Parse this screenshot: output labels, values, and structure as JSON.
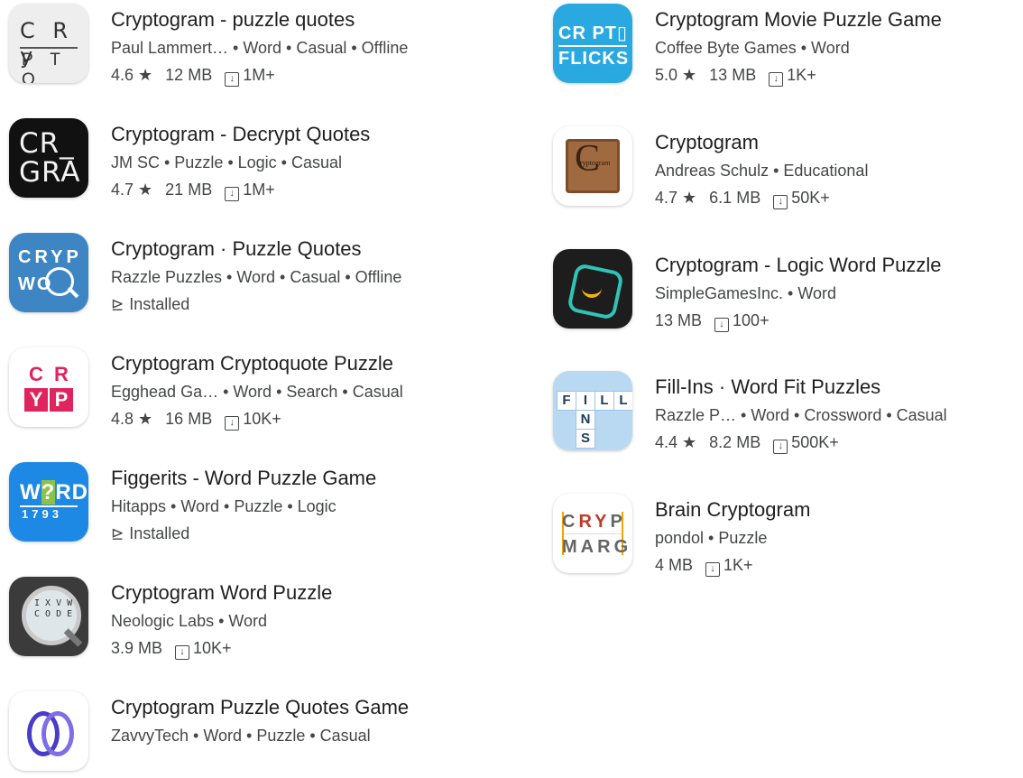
{
  "left_apps": [
    {
      "title": "Cryptogram - puzzle quotes",
      "meta": "Paul Lammert… • Word • Casual • Offline",
      "rating": "4.6 ★",
      "size": "12 MB",
      "downloads": "1M+"
    },
    {
      "title": "Cryptogram - Decrypt Quotes",
      "meta": "JM SC • Puzzle • Logic • Casual",
      "rating": "4.7 ★",
      "size": "21 MB",
      "downloads": "1M+"
    },
    {
      "title": "Cryptogram · Puzzle Quotes",
      "meta": "Razzle Puzzles • Word • Casual • Offline",
      "status": "Installed"
    },
    {
      "title": "Cryptogram Cryptoquote Puzzle",
      "meta": "Egghead Ga… • Word • Search • Casual",
      "rating": "4.8 ★",
      "size": "16 MB",
      "downloads": "10K+"
    },
    {
      "title": "Figgerits - Word Puzzle Game",
      "meta": "Hitapps • Word • Puzzle • Logic",
      "status": "Installed"
    },
    {
      "title": "Cryptogram Word Puzzle",
      "meta": "Neologic Labs • Word",
      "size": "3.9 MB",
      "downloads": "10K+"
    },
    {
      "title": "Cryptogram Puzzle Quotes Game",
      "meta": "ZavvyTech • Word • Puzzle • Casual"
    }
  ],
  "right_apps": [
    {
      "title": "Cryptogram Movie Puzzle Game",
      "meta": "Coffee Byte Games • Word",
      "rating": "5.0 ★",
      "size": "13 MB",
      "downloads": "1K+"
    },
    {
      "title": "Cryptogram",
      "meta": "Andreas  Schulz • Educational",
      "rating": "4.7 ★",
      "size": "6.1 MB",
      "downloads": "50K+"
    },
    {
      "title": "Cryptogram - Logic Word Puzzle",
      "meta": "SimpleGamesInc. • Word",
      "size": "13 MB",
      "downloads": "100+"
    },
    {
      "title": "Fill-Ins · Word Fit Puzzles",
      "meta": "Razzle P… • Word • Crossword • Casual",
      "rating": "4.4 ★",
      "size": "8.2 MB",
      "downloads": "500K+"
    },
    {
      "title": "Brain Cryptogram",
      "meta": "pondol • Puzzle",
      "size": "4 MB",
      "downloads": "1K+"
    }
  ],
  "icons": {
    "crypto1": {
      "r1": "C R y",
      "r2": "P T O"
    },
    "decrypt": {
      "l1": "CR_",
      "l2": "GRA"
    },
    "razzle": {
      "l1": "CRYP",
      "l2": "WO"
    },
    "egghead": {
      "c1": "C",
      "c2": "R",
      "c3": "Y",
      "c4": "P"
    },
    "figg": {
      "w1": "W",
      "q": "?",
      "w2": "RD",
      "n": "1793"
    },
    "neo": {
      "l1": "I X V W",
      "l2": "C O D E"
    },
    "flicks": {
      "l1": "CR PT▯",
      "l2": "FLICKS"
    },
    "schulz": {
      "c": "C",
      "s": "ryptogram"
    },
    "fill": {
      "f": "F",
      "i": "I",
      "l1": "L",
      "l2": "L",
      "n": "N",
      "s": "S"
    },
    "brain": {
      "r1a": "C",
      "r1b": "R",
      "r1c": "Y",
      "r1d": "P",
      "r2a": "M",
      "r2b": "A",
      "r2c": "R",
      "r2d": "G"
    }
  },
  "colors": {
    "accent_blue": "#1e88e5",
    "text": "#1f1f1f",
    "meta_text": "#444746"
  }
}
